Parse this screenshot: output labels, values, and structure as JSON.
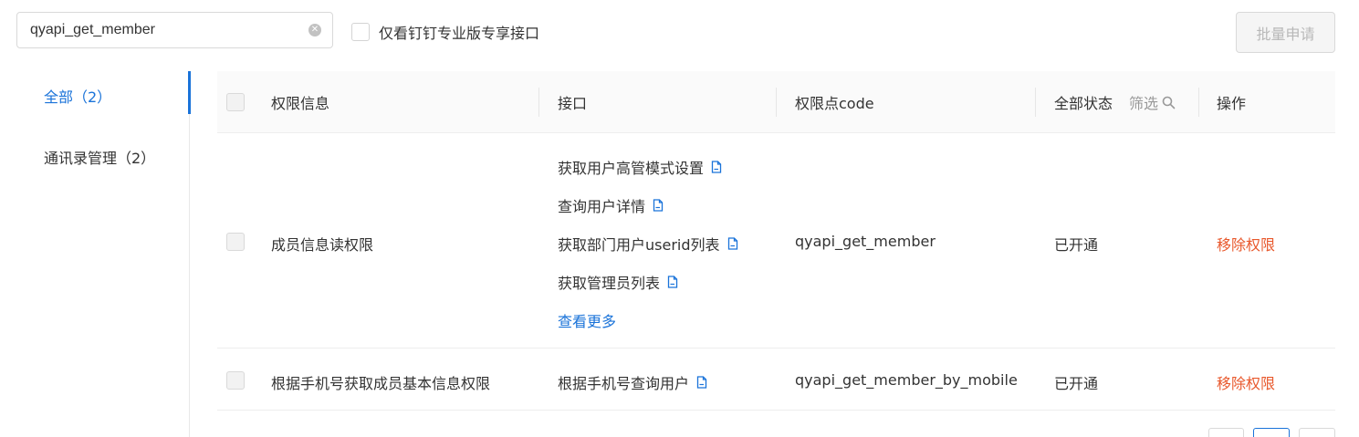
{
  "search": {
    "value": "qyapi_get_member"
  },
  "filter_checkbox": {
    "label": "仅看钉钉专业版专享接口"
  },
  "batch_button": {
    "label": "批量申请"
  },
  "sidebar": {
    "items": [
      {
        "label": "全部（2）"
      },
      {
        "label": "通讯录管理（2）"
      }
    ]
  },
  "table": {
    "headers": {
      "permission": "权限信息",
      "api": "接口",
      "code": "权限点code",
      "status": "全部状态",
      "filter": "筛选",
      "action": "操作"
    },
    "rows": [
      {
        "permission": "成员信息读权限",
        "apis": [
          "获取用户高管模式设置",
          "查询用户详情",
          "获取部门用户userid列表",
          "获取管理员列表"
        ],
        "more": "查看更多",
        "code": "qyapi_get_member",
        "status": "已开通",
        "action": "移除权限"
      },
      {
        "permission": "根据手机号获取成员基本信息权限",
        "apis": [
          "根据手机号查询用户"
        ],
        "code": "qyapi_get_member_by_mobile",
        "status": "已开通",
        "action": "移除权限"
      }
    ]
  },
  "colors": {
    "accent": "#1a73d9",
    "danger": "#e8582c"
  }
}
